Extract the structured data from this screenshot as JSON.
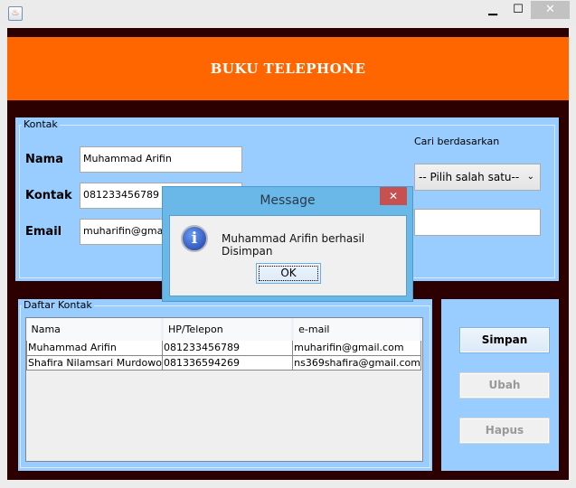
{
  "window": {
    "title": "",
    "icon": "java-icon",
    "minimize": "▁",
    "maximize": "☐",
    "close": "✕"
  },
  "header": {
    "title": "BUKU TELEPHONE"
  },
  "kontak": {
    "group_label": "Kontak",
    "nama_label": "Nama",
    "nama_value": "Muhammad Arifin",
    "kontak_label": "Kontak",
    "kontak_value": "081233456789",
    "email_label": "Email",
    "email_value": "muharifin@gmail.com"
  },
  "search": {
    "label": "Cari berdasarkan",
    "selected": "-- Pilih salah satu--",
    "value": ""
  },
  "daftar": {
    "group_label": "Daftar Kontak",
    "columns": [
      "Nama",
      "HP/Telepon",
      "e-mail"
    ],
    "rows": [
      [
        "Muhammad Arifin",
        "081233456789",
        "muharifin@gmail.com"
      ],
      [
        "Shafira Nilamsari Murdowo",
        "081336594269",
        "ns369shafira@gmail.com"
      ]
    ]
  },
  "actions": {
    "simpan": "Simpan",
    "ubah": "Ubah",
    "hapus": "Hapus"
  },
  "dialog": {
    "title": "Message",
    "message": "Muhammad Arifin berhasil Disimpan",
    "ok": "OK",
    "close": "✕",
    "icon": "i"
  },
  "colors": {
    "header": "#ff6600",
    "background": "#2d0000",
    "panel": "#99ccff"
  }
}
